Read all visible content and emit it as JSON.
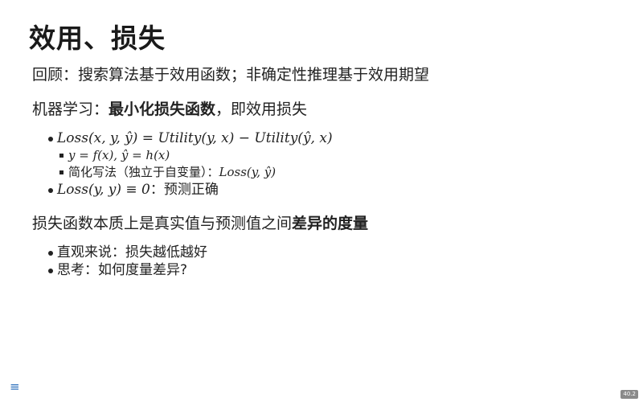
{
  "title": "效用、损失",
  "recall": "回顾：搜索算法基于效用函数；非确定性推理基于效用期望",
  "ml": {
    "prefix": "机器学习：",
    "bold": "最小化损失函数",
    "suffix": "，即效用损失"
  },
  "bullets": {
    "b1_math": "Loss(x, y, ŷ) = Utility(y, x) − Utility(ŷ, x)",
    "b1a_math": "y = f(x), ŷ = h(x)",
    "b1b_text": "简化写法（独立于自变量）：",
    "b1b_math": "Loss(y, ŷ)",
    "b2_math": "Loss(y, y) ≡ 0",
    "b2_text": "：预测正确"
  },
  "essence": {
    "prefix": "损失函数本质上是真实值与预测值之间",
    "bold": "差异的度量"
  },
  "bullets2": [
    "直观来说：损失越低越好",
    "思考：如何度量差异?"
  ],
  "footer": {
    "menu_icon": "menu-icon",
    "page_number": "40.2"
  }
}
